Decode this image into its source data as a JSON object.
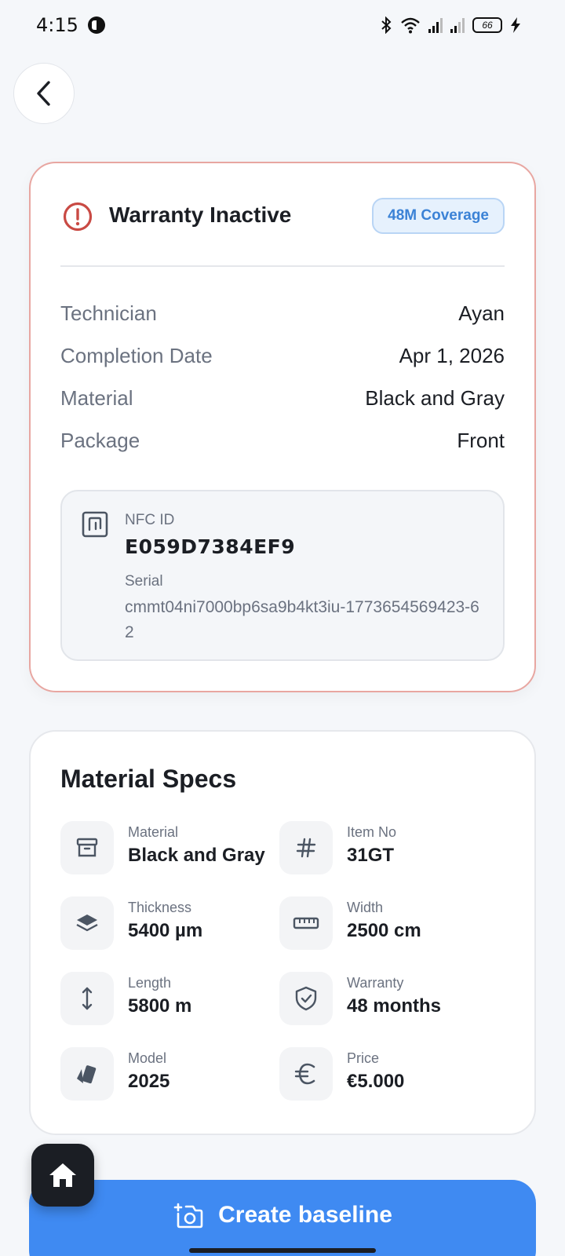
{
  "status_bar": {
    "time": "4:15",
    "battery": "66"
  },
  "warranty": {
    "title": "Warranty Inactive",
    "badge": "48M Coverage",
    "rows": [
      {
        "label": "Technician",
        "value": "Ayan"
      },
      {
        "label": "Completion Date",
        "value": "Apr 1, 2026"
      },
      {
        "label": "Material",
        "value": "Black and Gray"
      },
      {
        "label": "Package",
        "value": "Front"
      }
    ],
    "nfc": {
      "id_label": "NFC ID",
      "id_value": "E059D7384EF9",
      "serial_label": "Serial",
      "serial_value": "cmmt04ni7000bp6sa9b4kt3iu-1773654569423-62"
    }
  },
  "specs": {
    "title": "Material Specs",
    "items": [
      {
        "label": "Material",
        "value": "Black and Gray",
        "icon": "archive-icon"
      },
      {
        "label": "Item No",
        "value": "31GT",
        "icon": "hash-icon"
      },
      {
        "label": "Thickness",
        "value": "5400 µm",
        "icon": "layers-icon"
      },
      {
        "label": "Width",
        "value": "2500 cm",
        "icon": "ruler-icon"
      },
      {
        "label": "Length",
        "value": "5800 m",
        "icon": "vertical-arrows-icon"
      },
      {
        "label": "Warranty",
        "value": "48 months",
        "icon": "shield-check-icon"
      },
      {
        "label": "Model",
        "value": "2025",
        "icon": "swatch-icon"
      },
      {
        "label": "Price",
        "value": "€5.000",
        "icon": "euro-icon"
      }
    ]
  },
  "cta": {
    "label": "Create baseline",
    "icon": "camera-plus-icon"
  },
  "colors": {
    "accent": "#3f8af2",
    "alert": "#c94a44",
    "badge_text": "#3b82d6"
  }
}
